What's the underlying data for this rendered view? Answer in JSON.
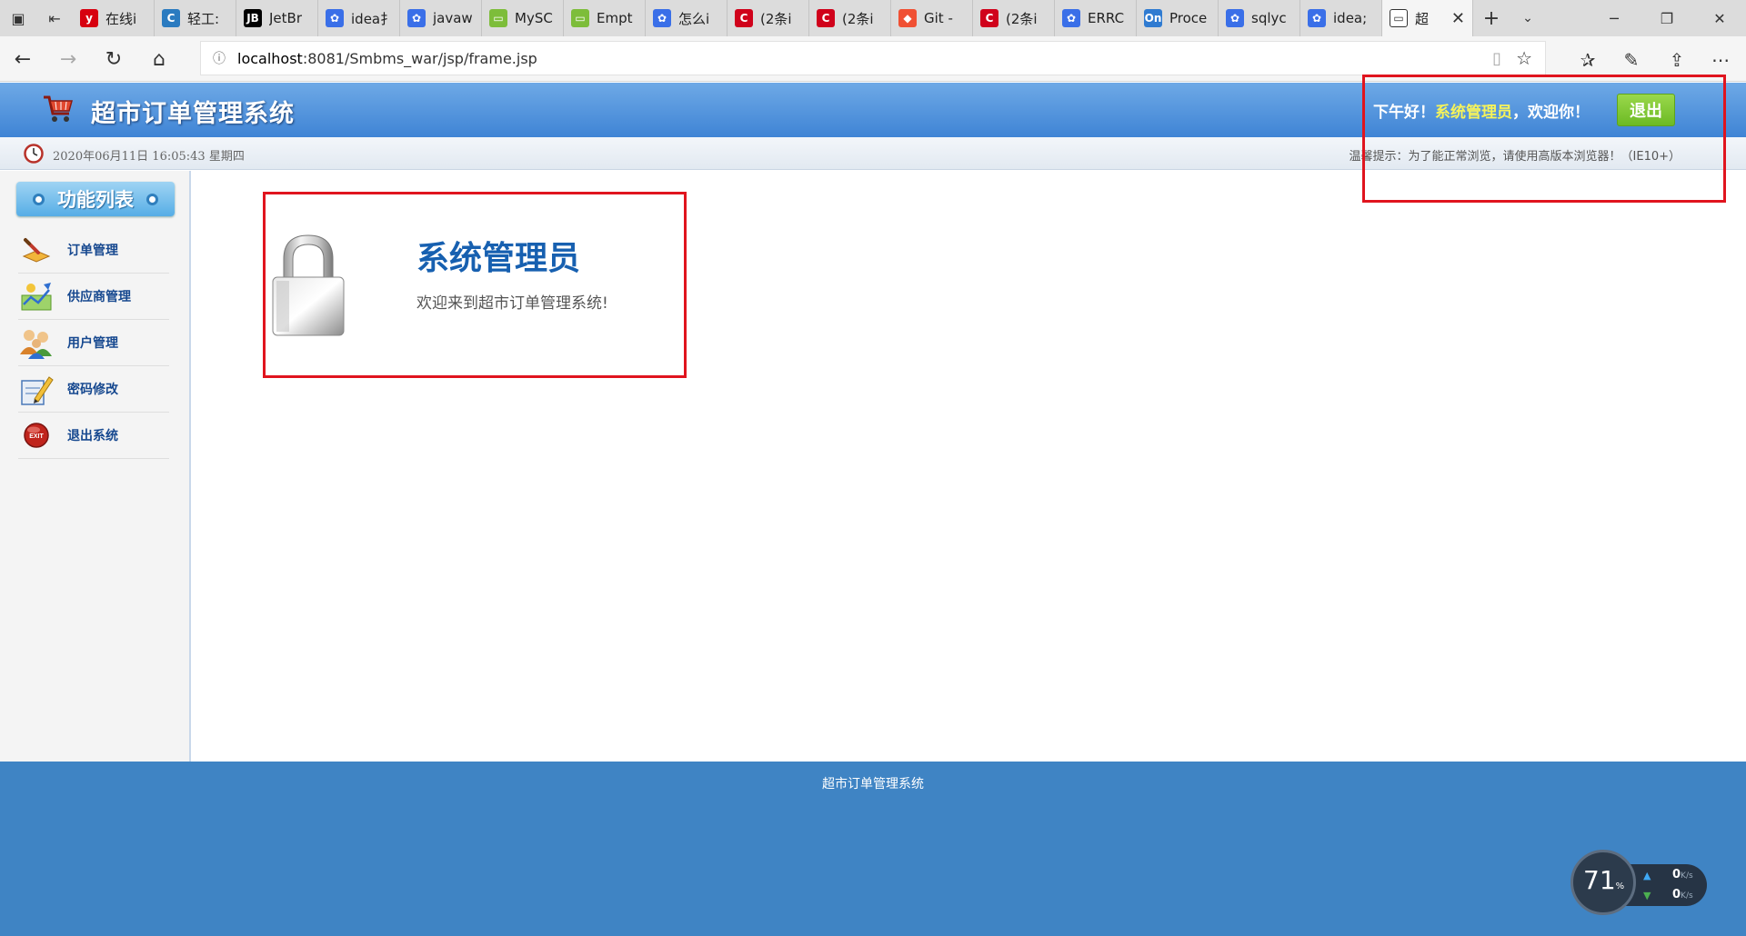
{
  "browser": {
    "tabs": [
      {
        "icon": "youdao-icon",
        "color": "#d7000f",
        "glyph": "y",
        "title": "在线i"
      },
      {
        "icon": "c-blog-icon",
        "color": "#2a7bc0",
        "glyph": "C",
        "title": "轻工:"
      },
      {
        "icon": "jetbrains-icon",
        "color": "#000000",
        "glyph": "JB",
        "title": "JetBr"
      },
      {
        "icon": "baidu-paw-icon",
        "color": "#3a6fe8",
        "glyph": "✿",
        "title": "idea扌"
      },
      {
        "icon": "baidu-paw-icon",
        "color": "#3a6fe8",
        "glyph": "✿",
        "title": "javaw"
      },
      {
        "icon": "green-page-icon",
        "color": "#7dbd3a",
        "glyph": "▭",
        "title": "MySC"
      },
      {
        "icon": "green-page-icon",
        "color": "#7dbd3a",
        "glyph": "▭",
        "title": "Empt"
      },
      {
        "icon": "baidu-paw-icon",
        "color": "#3a6fe8",
        "glyph": "✿",
        "title": "怎么i"
      },
      {
        "icon": "csdn-icon",
        "color": "#d0021b",
        "glyph": "C",
        "title": "(2条i"
      },
      {
        "icon": "csdn-icon",
        "color": "#d0021b",
        "glyph": "C",
        "title": "(2条i"
      },
      {
        "icon": "git-icon",
        "color": "#f05033",
        "glyph": "◆",
        "title": "Git -"
      },
      {
        "icon": "csdn-icon",
        "color": "#d0021b",
        "glyph": "C",
        "title": "(2条i"
      },
      {
        "icon": "baidu-paw-icon",
        "color": "#3a6fe8",
        "glyph": "✿",
        "title": "ERRC"
      },
      {
        "icon": "processon-icon",
        "color": "#2f7bd1",
        "glyph": "On",
        "title": "Proce"
      },
      {
        "icon": "baidu-paw-icon",
        "color": "#3a6fe8",
        "glyph": "✿",
        "title": "sqlyc"
      },
      {
        "icon": "baidu-paw-icon",
        "color": "#3a6fe8",
        "glyph": "✿",
        "title": "idea;"
      }
    ],
    "active_tab": {
      "title": "超"
    },
    "url_host": "localhost",
    "url_rest": ":8081/Smbms_war/jsp/frame.jsp"
  },
  "app": {
    "title": "超市订单管理系统",
    "greeting_prefix": "下午好！",
    "username": "系统管理员",
    "greeting_suffix": "，欢迎你！",
    "logout_label": "退出",
    "datetime": "2020年06月11日 16:05:43 星期四",
    "tip": "温馨提示：为了能正常浏览，请使用高版本浏览器！（IE10+）"
  },
  "sidebar": {
    "heading": "功能列表",
    "items": [
      {
        "label": "订单管理",
        "icon": "order-icon"
      },
      {
        "label": "供应商管理",
        "icon": "supplier-icon"
      },
      {
        "label": "用户管理",
        "icon": "users-icon"
      },
      {
        "label": "密码修改",
        "icon": "password-edit-icon"
      },
      {
        "label": "退出系统",
        "icon": "exit-icon"
      }
    ]
  },
  "main": {
    "role": "系统管理员",
    "welcome": "欢迎来到超市订单管理系统!"
  },
  "footer": {
    "text": "超市订单管理系统"
  },
  "net_widget": {
    "percent": "71",
    "percent_unit": "%",
    "upload": "0",
    "download": "0",
    "rate_unit": "K/s"
  },
  "colors": {
    "header_blue": "#3f84d5",
    "footer_blue": "#3f84c4",
    "annotation_red": "#e0141e",
    "username_yellow": "#f6f35a",
    "logout_green": "#6cba24"
  }
}
